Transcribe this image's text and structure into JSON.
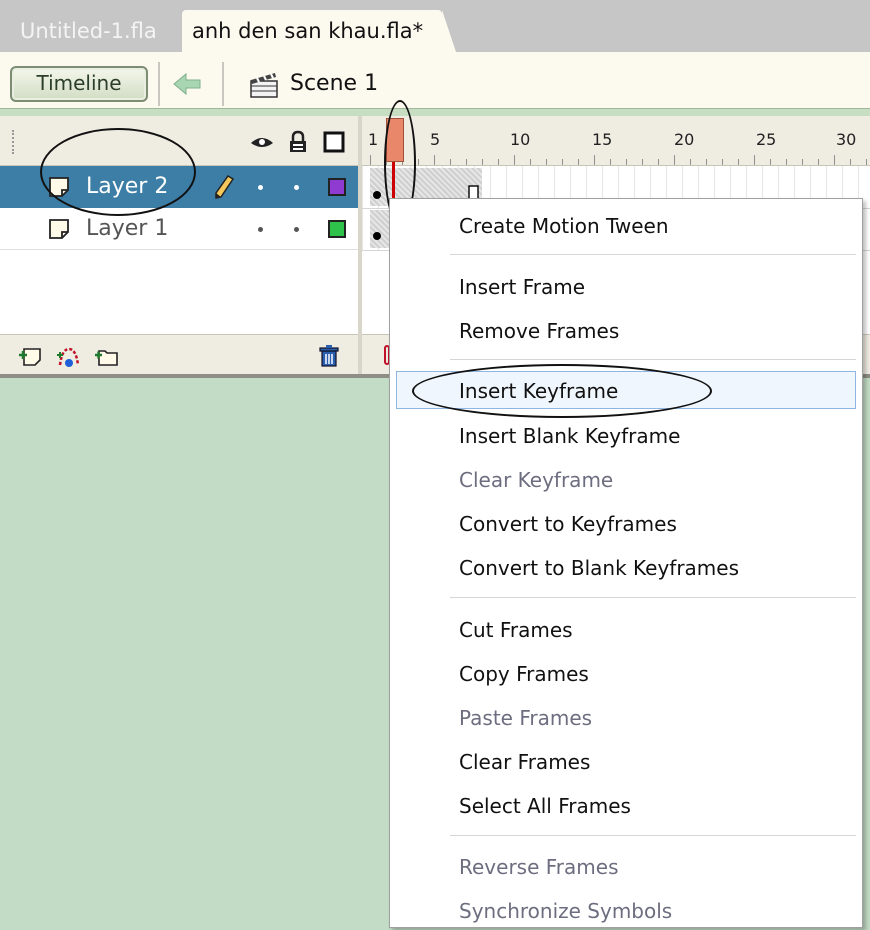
{
  "tabs": [
    {
      "label": "Untitled-1.fla",
      "active": false
    },
    {
      "label": "anh den san khau.fla*",
      "active": true
    }
  ],
  "toolbar": {
    "timeline_label": "Timeline",
    "back_icon": "back-arrow-icon",
    "scene_icon": "clapperboard-icon",
    "scene_label": "Scene 1"
  },
  "timeline": {
    "header_icons": [
      "eye-icon",
      "lock-icon",
      "outline-icon"
    ],
    "ruler_labels": [
      "1",
      "5",
      "10",
      "15",
      "20",
      "25",
      "30"
    ],
    "layers": [
      {
        "name": "Layer 2",
        "selected": true,
        "color": "#8f3bd1",
        "editing": true
      },
      {
        "name": "Layer 1",
        "selected": false,
        "color": "#2ec24a",
        "editing": false
      }
    ],
    "footer_icons": [
      "insert-layer-icon",
      "add-motion-guide-icon",
      "insert-folder-icon",
      "trash-icon"
    ]
  },
  "context_menu": {
    "items": [
      {
        "label": "Create Motion Tween",
        "enabled": true
      },
      {
        "label": "Insert Frame",
        "enabled": true
      },
      {
        "label": "Remove Frames",
        "enabled": true
      },
      {
        "label": "Insert Keyframe",
        "enabled": true,
        "hover": true
      },
      {
        "label": "Insert Blank Keyframe",
        "enabled": true
      },
      {
        "label": "Clear Keyframe",
        "enabled": false
      },
      {
        "label": "Convert to Keyframes",
        "enabled": true
      },
      {
        "label": "Convert to Blank Keyframes",
        "enabled": true
      },
      {
        "label": "Cut Frames",
        "enabled": true
      },
      {
        "label": "Copy Frames",
        "enabled": true
      },
      {
        "label": "Paste Frames",
        "enabled": false
      },
      {
        "label": "Clear Frames",
        "enabled": true
      },
      {
        "label": "Select All Frames",
        "enabled": true
      },
      {
        "label": "Reverse Frames",
        "enabled": false
      },
      {
        "label": "Synchronize Symbols",
        "enabled": false
      }
    ]
  },
  "colors": {
    "selected_row": "#3d7ea6",
    "stage_background": "#c3dcc5",
    "playhead": "#e9876b"
  }
}
